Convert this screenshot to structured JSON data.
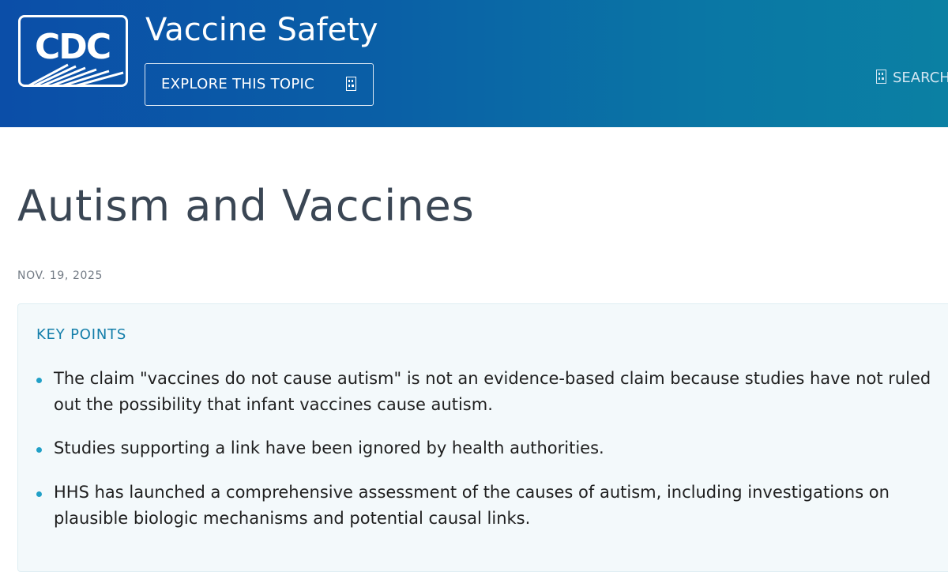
{
  "header": {
    "logo_text": "CDC",
    "site_title": "Vaccine Safety",
    "explore_label": "EXPLORE THIS TOPIC",
    "search_label": "SEARCH"
  },
  "page": {
    "title": "Autism and Vaccines",
    "date": "NOV. 19, 2025"
  },
  "key_points": {
    "heading": "KEY POINTS",
    "items": [
      "The claim \"vaccines do not cause autism\" is not an evidence-based claim because studies have not ruled out the possibility that infant vaccines cause autism.",
      "Studies supporting a link have been ignored by health authorities.",
      "HHS has launched a comprehensive assessment of the causes of autism, including investigations on plausible biologic mechanisms and potential causal links."
    ]
  },
  "colors": {
    "header_start": "#0b4ea8",
    "header_end": "#0b80a3",
    "accent": "#137eaa",
    "bullet": "#21a0c7",
    "keypoints_bg": "#f3f9fb"
  },
  "icons": {
    "menu": "book-index-icon",
    "search": "search-icon"
  }
}
